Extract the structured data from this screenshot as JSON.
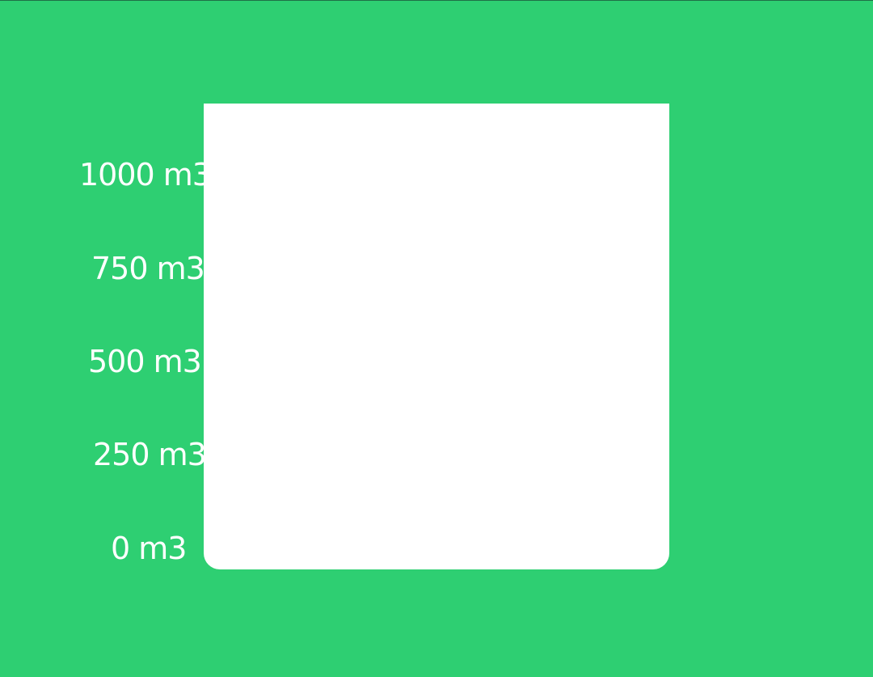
{
  "gauge": {
    "unit": "m3",
    "max": 1000,
    "fill_fraction": 0,
    "ticks": [
      "1000 m3",
      "750 m3",
      "500 m3",
      "250 m3",
      "0 m3"
    ]
  },
  "colors": {
    "background": "#2ecf72",
    "tank": "#ffffff",
    "label": "#ffffff"
  }
}
